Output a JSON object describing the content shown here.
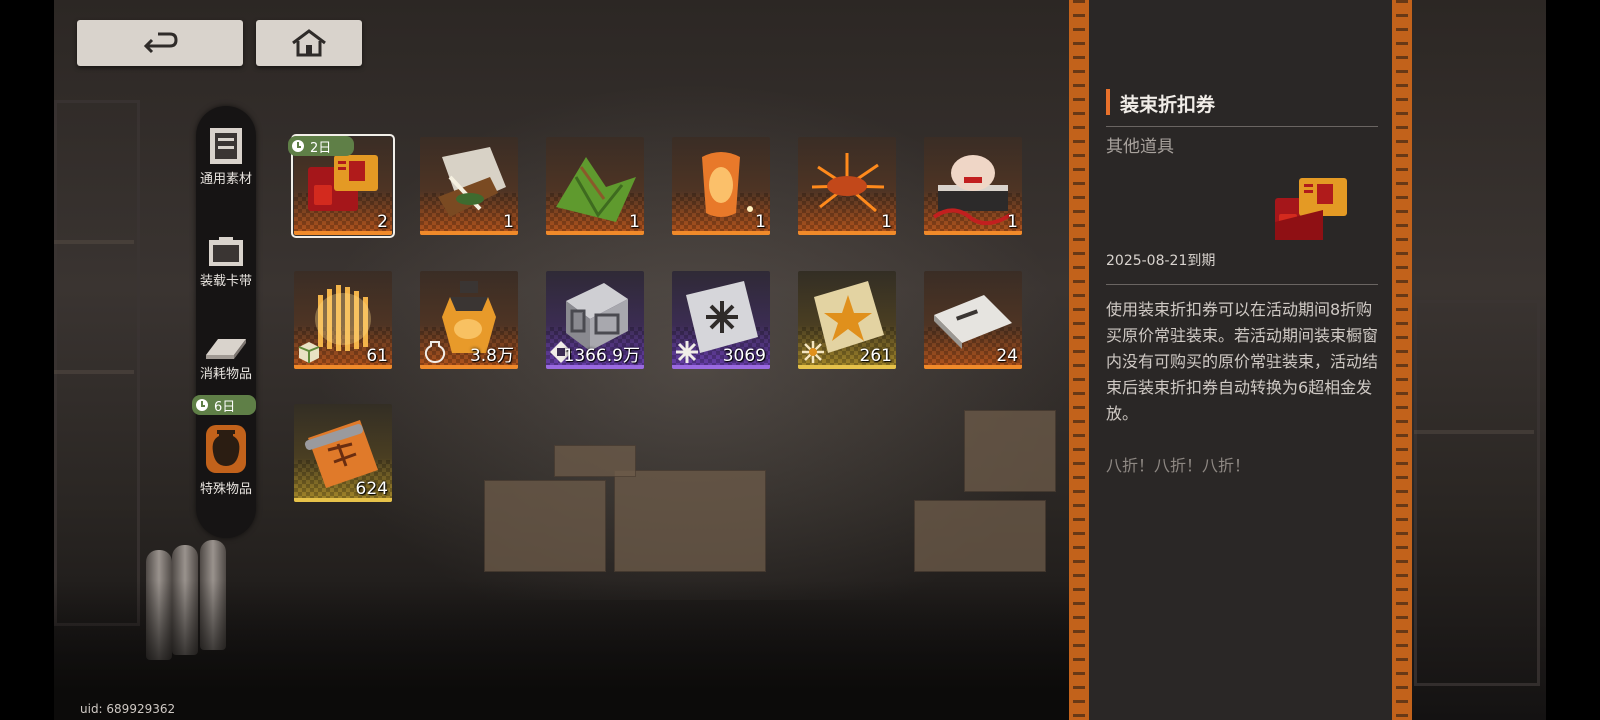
{
  "nav": {
    "back_icon": "back-arrow-icon",
    "home_icon": "home-icon"
  },
  "sidebar": {
    "categories": [
      {
        "label": "通用素材",
        "icon": "box-icon"
      },
      {
        "label": "装载卡带",
        "icon": "cartridge-icon"
      },
      {
        "label": "消耗物品",
        "icon": "plate-icon"
      },
      {
        "label": "特殊物品",
        "icon": "vase-icon",
        "selected": true,
        "badge": "6日"
      }
    ]
  },
  "inventory": {
    "items": [
      {
        "name": "装束折扣券",
        "count": "2",
        "badge": "2日",
        "rarity": "orange",
        "selected": true
      },
      {
        "name": "scroll-bundle",
        "count": "1",
        "rarity": "orange"
      },
      {
        "name": "zongzi",
        "count": "1",
        "rarity": "orange"
      },
      {
        "name": "sky-lantern",
        "count": "1",
        "rarity": "orange"
      },
      {
        "name": "firework",
        "count": "1",
        "rarity": "orange"
      },
      {
        "name": "gift-box",
        "count": "1",
        "rarity": "orange"
      },
      {
        "name": "crystal-cluster",
        "count": "61",
        "rarity": "orange"
      },
      {
        "name": "amber-bottle",
        "count": "3.8万",
        "rarity": "orange"
      },
      {
        "name": "silver-chip",
        "count": "1366.9万",
        "rarity": "purple"
      },
      {
        "name": "star-card",
        "count": "3069",
        "rarity": "purple"
      },
      {
        "name": "gold-star-card",
        "count": "261",
        "rarity": "gold"
      },
      {
        "name": "white-ticket",
        "count": "24",
        "rarity": "orange"
      },
      {
        "name": "orange-scroll",
        "count": "624",
        "rarity": "gold"
      }
    ]
  },
  "detail": {
    "title": "装束折扣券",
    "category": "其他道具",
    "expiry": "2025-08-21到期",
    "description": "使用装束折扣券可以在活动期间8折购买原价常驻装束。若活动期间装束橱窗内没有可购买的原价常驻装束，活动结束后装束折扣券自动转换为6超相金发放。",
    "flavor": "八折！八折！八折！"
  },
  "footer": {
    "uid": "uid: 689929362"
  },
  "colors": {
    "accent": "#e8712b",
    "badge_green": "#5f7f47",
    "panel_bg": "#2a2726",
    "rarity_orange": "#f08a2a",
    "rarity_purple": "#9a6ae0",
    "rarity_gold": "#e6c24a"
  }
}
